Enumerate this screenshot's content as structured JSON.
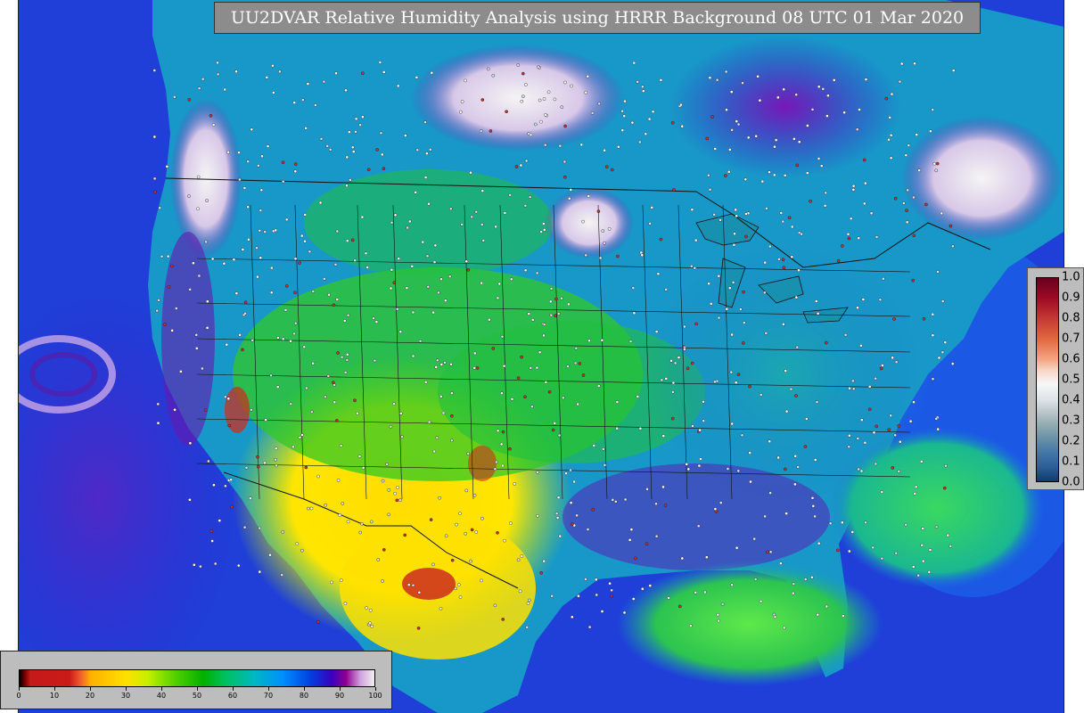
{
  "title": "UU2DVAR Relative Humidity Analysis using HRRR Background 08 UTC 01 Mar 2020",
  "rh_colorbar": {
    "ticks": [
      "0",
      "10",
      "20",
      "30",
      "40",
      "50",
      "60",
      "70",
      "80",
      "90",
      "100"
    ],
    "colors": [
      "#000000",
      "#c41a1a",
      "#ffb000",
      "#ffe000",
      "#c8f000",
      "#50d000",
      "#00b000",
      "#00b8c0",
      "#0090ff",
      "#0040e0",
      "#900090",
      "#f0f0f0"
    ]
  },
  "increment_colorbar": {
    "ticks": [
      "1.0",
      "0.9",
      "0.8",
      "0.7",
      "0.6",
      "0.5",
      "0.4",
      "0.3",
      "0.2",
      "0.1",
      "0.0"
    ],
    "colors": [
      "#67001f",
      "#c43a32",
      "#f4a582",
      "#f7f7f7",
      "#93acb0",
      "#4277a8",
      "#103a6b"
    ]
  },
  "map": {
    "ocean_color": "#1f3fd8",
    "land_colors": {
      "moist": "#1898c8",
      "humid_green": "#28c41a",
      "dry_yellow": "#f0e000",
      "very_dry_red": "#c43030",
      "saturated_white": "#e8e8e8",
      "purple": "#6a18b0"
    }
  }
}
